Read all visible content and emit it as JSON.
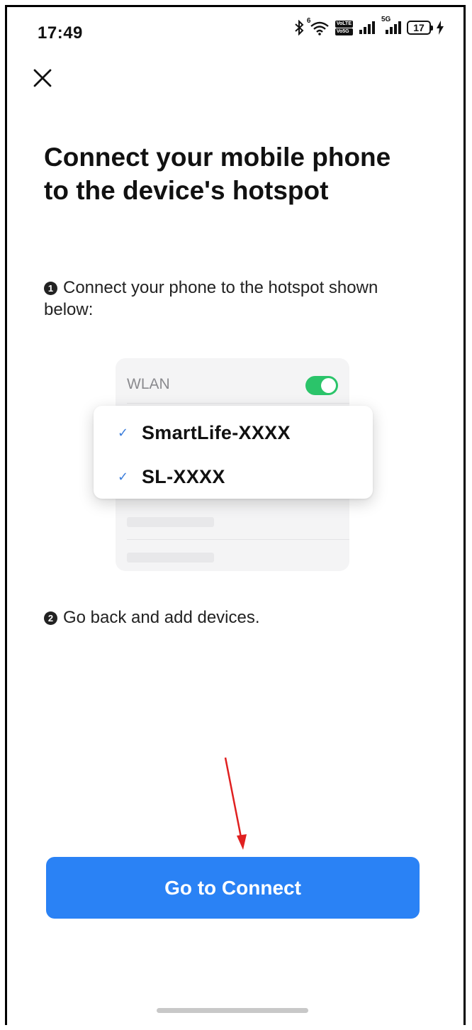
{
  "status_bar": {
    "time": "17:49",
    "wifi_badge": "6",
    "sim1_label": "VoLTE",
    "sim1_index": "1",
    "sim2_label": "Vo5G",
    "sim2_index": "2",
    "network_type": "5G",
    "battery_level": "17"
  },
  "page": {
    "title": "Connect your mobile phone to the device's hotspot",
    "step1_marker": "1",
    "step1_text": "Connect your phone to the hotspot shown below:",
    "step2_marker": "2",
    "step2_text": "Go back and add devices."
  },
  "illustration": {
    "wlan_label": "WLAN",
    "wlan_toggle_on": true,
    "networks": [
      {
        "name": "SmartLife-XXXX"
      },
      {
        "name": "SL-XXXX"
      }
    ]
  },
  "actions": {
    "primary_button_label": "Go to Connect"
  },
  "colors": {
    "primary": "#2a82f5",
    "toggle_on": "#2bc46a",
    "check": "#3b7ddb",
    "annotation_arrow": "#e02020"
  }
}
